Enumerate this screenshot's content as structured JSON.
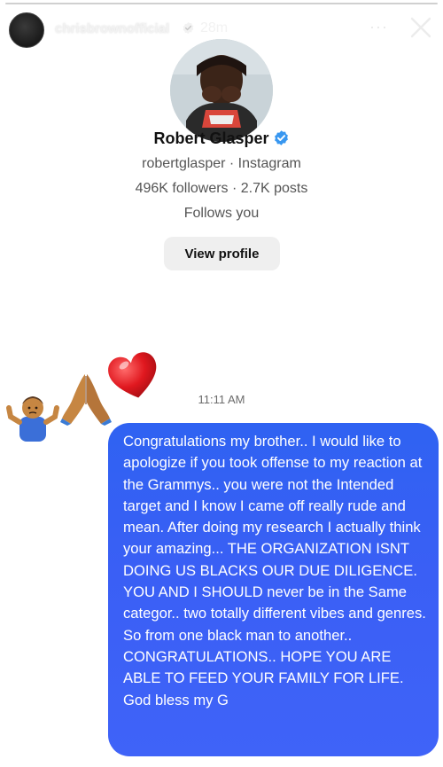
{
  "story": {
    "progress": 0.0,
    "poster_name": "chrisbrownofficial",
    "time_ago": "28m",
    "more_label": "···"
  },
  "profile": {
    "name": "Robert Glasper",
    "subtitle": "robertglasper · Instagram",
    "stats": "496K followers · 2.7K posts",
    "follows_note": "Follows you",
    "view_profile_label": "View profile"
  },
  "conversation": {
    "timestamp": "11:11 AM",
    "reactions": [
      "heart-emoji",
      "praying-hands-emoji",
      "shrugging-man-emoji"
    ],
    "message": "Congratulations my brother.. I would like to apologize if you took offense to my reaction at the Grammys.. you were not the Intended target and I know I came off really rude and mean. After doing my research I actually think your amazing... THE ORGANIZATION ISNT DOING US BLACKS OUR DUE DILIGENCE. YOU AND I SHOULD never be in the Same categor.. two totally different vibes and genres. So from one black man to another.. CONGRATULATIONS.. HOPE YOU ARE ABLE TO FEED YOUR FAMILY FOR LIFE. God bless my G"
  },
  "colors": {
    "bubble": "#3a5ff5",
    "verified": "#3897f0",
    "button_bg": "#efefef"
  }
}
